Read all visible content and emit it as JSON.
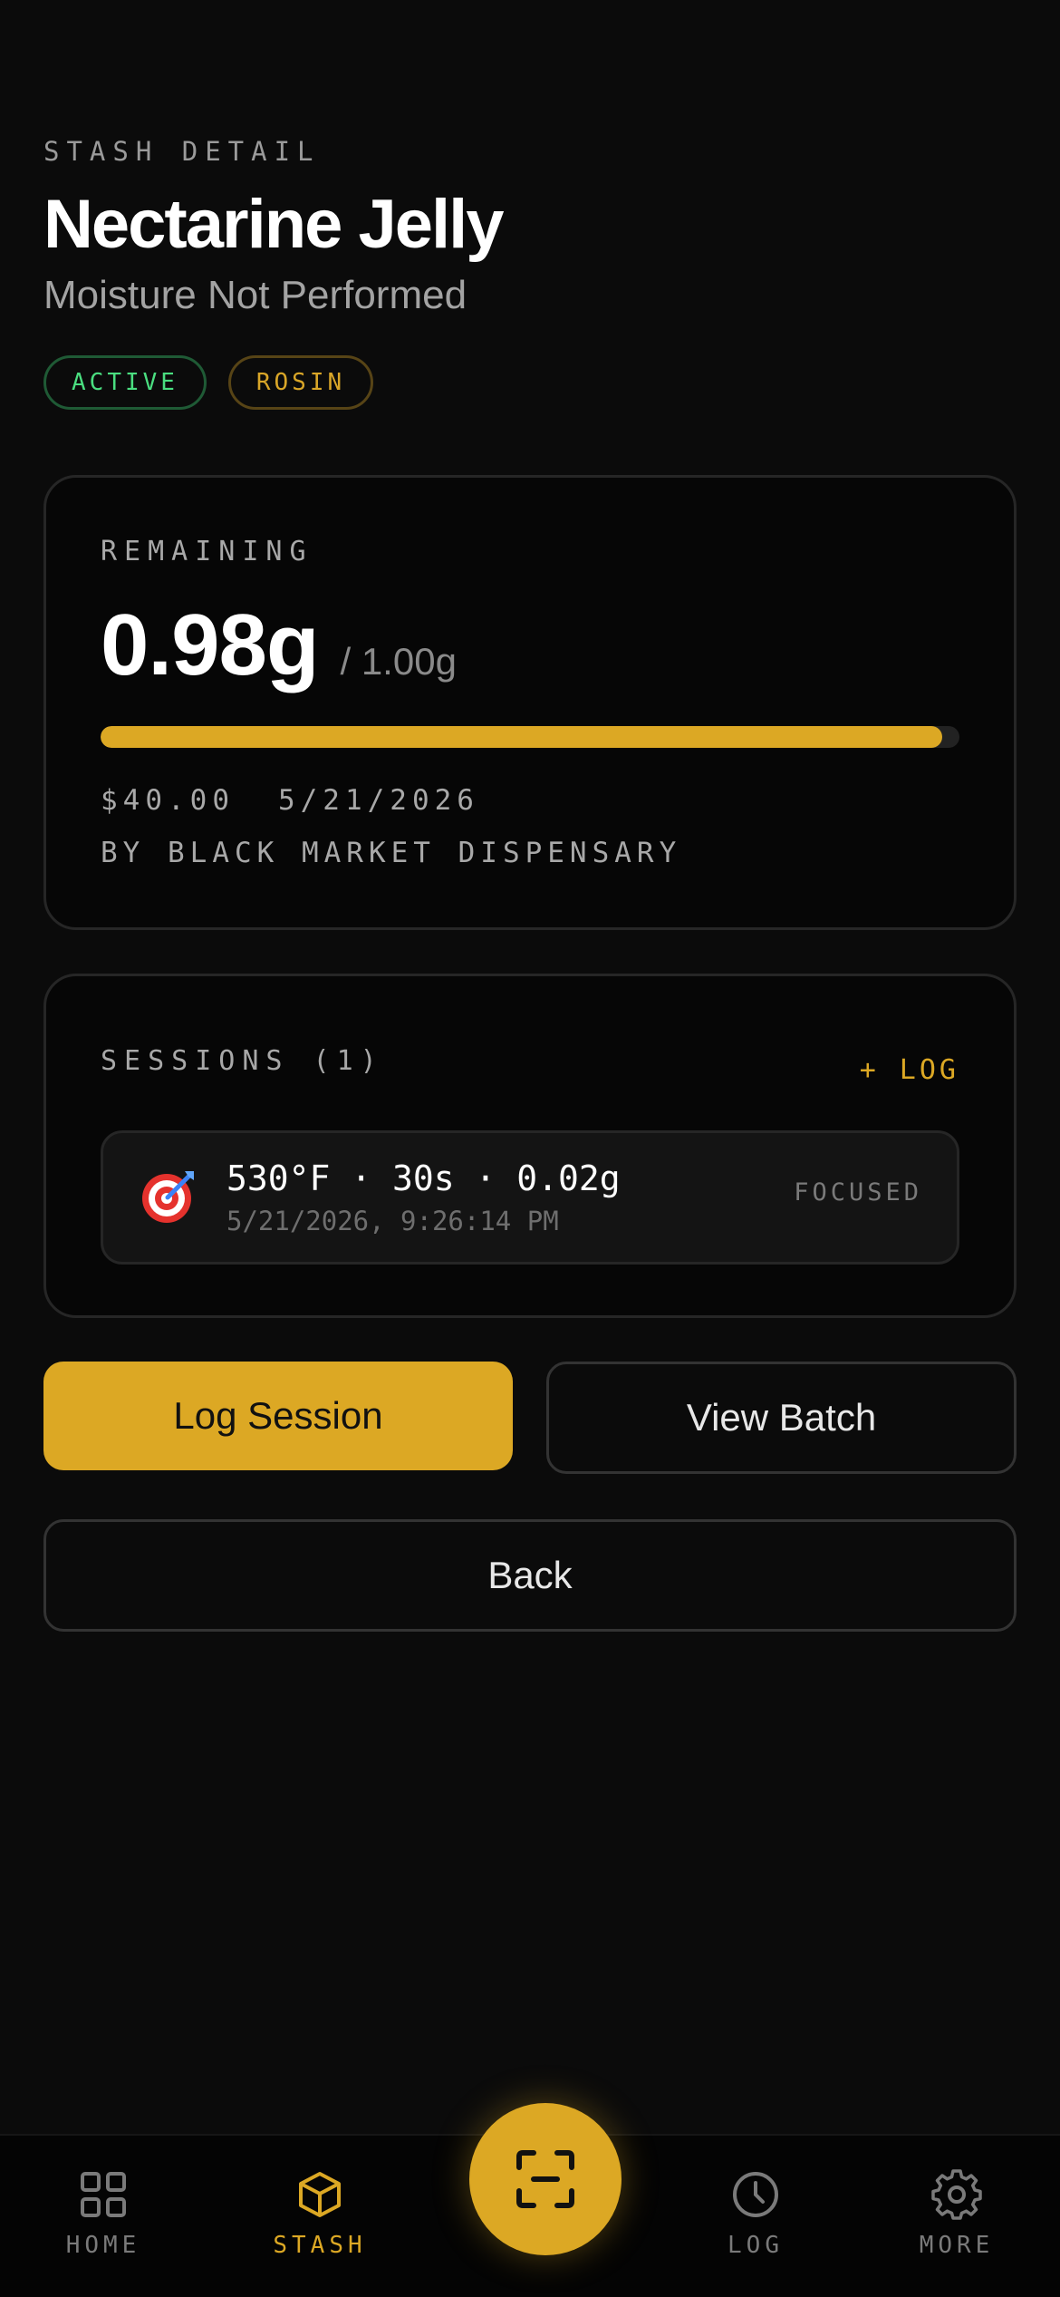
{
  "header": {
    "eyebrow": "STASH DETAIL",
    "title": "Nectarine Jelly",
    "subtitle": "Moisture Not Performed",
    "badges": [
      {
        "label": "ACTIVE",
        "color": "#4ade80"
      },
      {
        "label": "ROSIN",
        "color": "#d9a628"
      }
    ]
  },
  "remaining": {
    "label": "REMAINING",
    "amount": "0.98g",
    "total": "/ 1.00g",
    "fraction_remaining": 0.98,
    "price": "$40.00",
    "date": "5/21/2026",
    "vendor": "BY BLACK MARKET DISPENSARY"
  },
  "sessions": {
    "label": "SESSIONS (1)",
    "log_link": "+ LOG",
    "items": [
      {
        "icon": "target-icon",
        "summary": "530°F · 30s · 0.02g",
        "timestamp": "5/21/2026, 9:26:14 PM",
        "mood": "FOCUSED"
      }
    ]
  },
  "actions": {
    "log_session": "Log Session",
    "view_batch": "View Batch",
    "back": "Back"
  },
  "tabbar": {
    "tabs": [
      {
        "label": "HOME",
        "icon": "grid-icon",
        "active": false
      },
      {
        "label": "STASH",
        "icon": "box-icon",
        "active": true
      },
      {
        "label": "LOG",
        "icon": "clock-icon",
        "active": false
      },
      {
        "label": "MORE",
        "icon": "gear-icon",
        "active": false
      }
    ],
    "center_button_icon": "scan-icon"
  },
  "colors": {
    "accent": "#dca824",
    "background": "#0b0b0b",
    "active_green": "#4ade80"
  }
}
